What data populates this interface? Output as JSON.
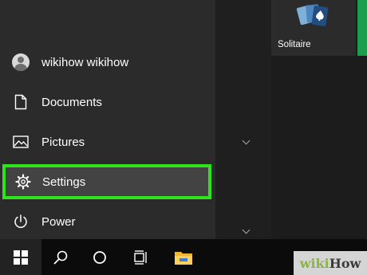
{
  "user": {
    "name": "wikihow wikihow"
  },
  "menu": {
    "documents": "Documents",
    "pictures": "Pictures",
    "settings": "Settings",
    "power": "Power"
  },
  "tiles": {
    "solitaire": "Solitaire"
  },
  "watermark": {
    "part1": "wiki",
    "part2": "How"
  },
  "colors": {
    "highlight": "#2ee31c",
    "tile_accent": "#1d9e4f"
  }
}
